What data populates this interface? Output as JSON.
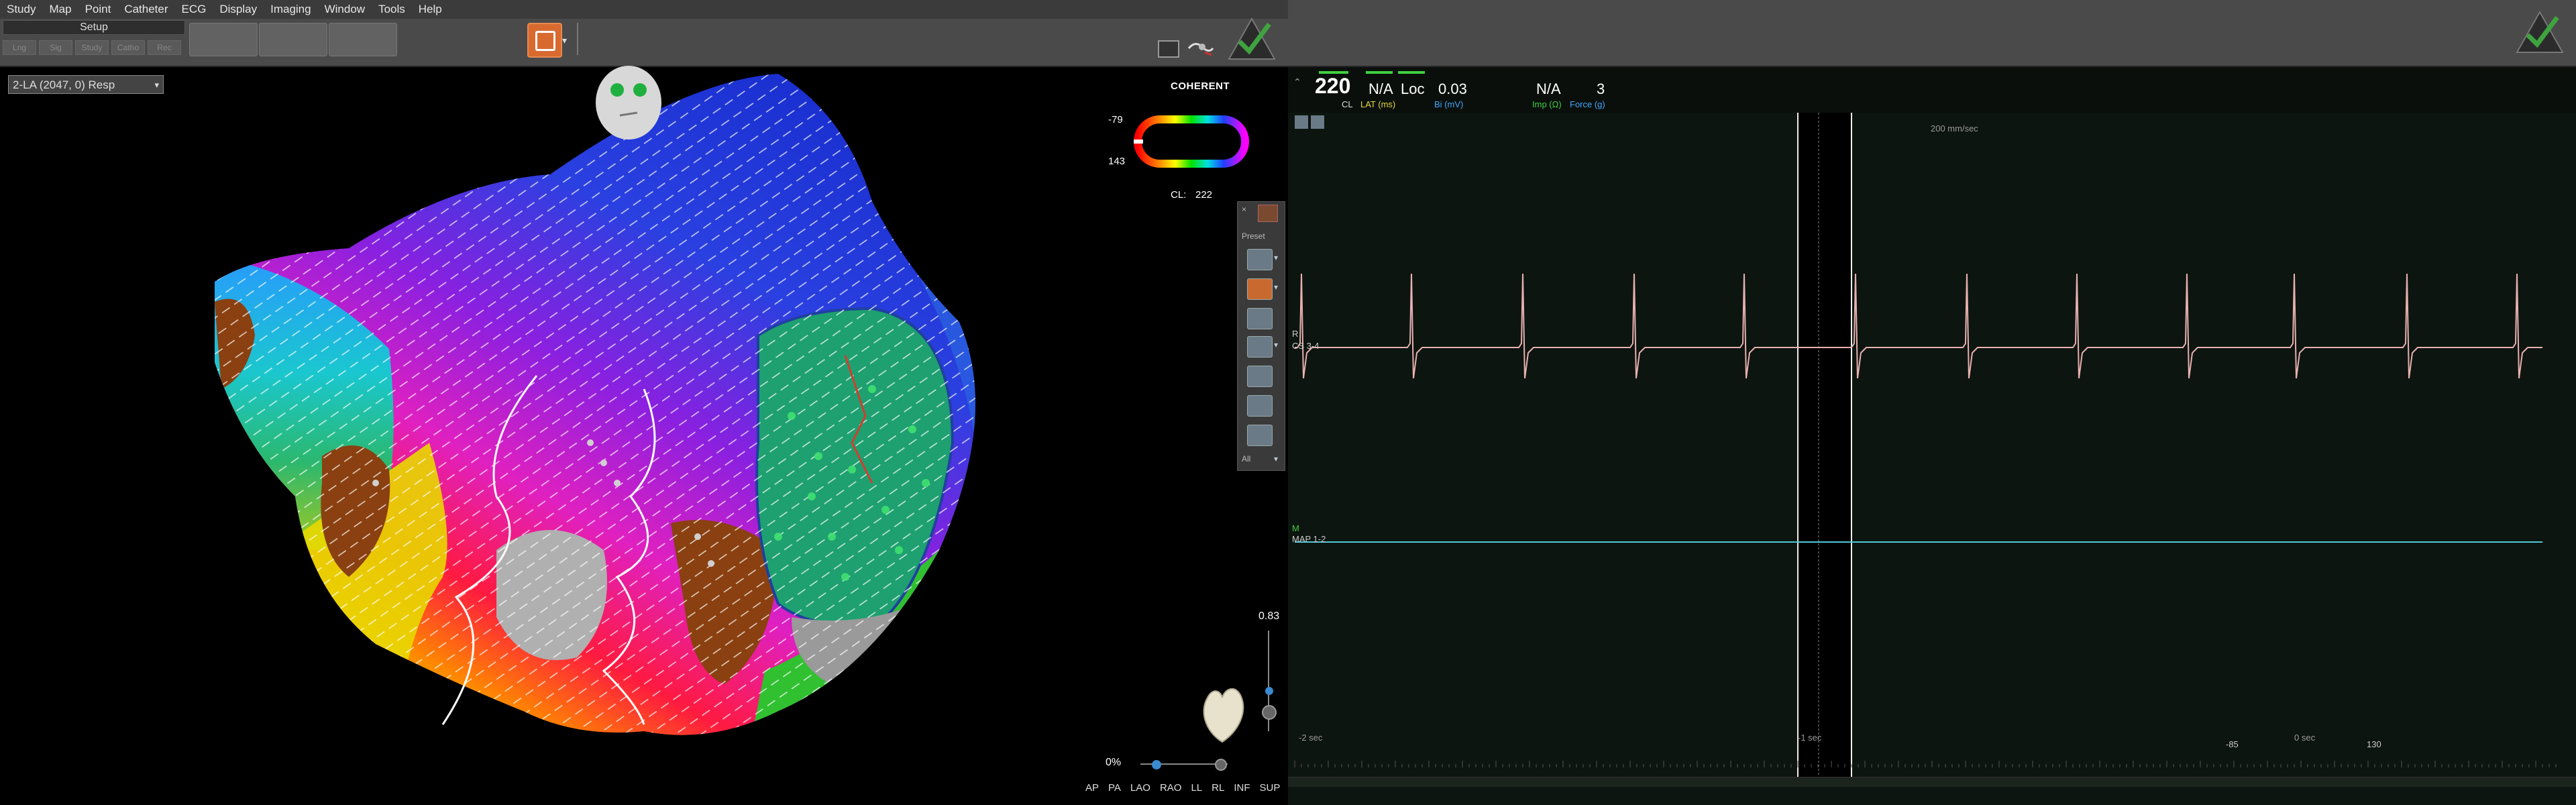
{
  "menu": [
    "Study",
    "Map",
    "Point",
    "Catheter",
    "ECG",
    "Display",
    "Imaging",
    "Window",
    "Tools",
    "Help"
  ],
  "setup": {
    "label": "Setup",
    "tabs": [
      "Lng",
      "Sig",
      "Study",
      "Catho",
      "Rec"
    ]
  },
  "map": {
    "selector": "2-LA (2047, 0) Resp",
    "mode": "COHERENT",
    "scale_top": "-79",
    "scale_bottom": "143",
    "cl_label": "CL:",
    "cl_value": "222",
    "zoom": "0.83",
    "opacity": "0%",
    "views": [
      "AP",
      "PA",
      "LAO",
      "RAO",
      "LL",
      "RL",
      "INF",
      "SUP"
    ],
    "tools_preset": "Preset",
    "tools_all": "All"
  },
  "ecg": {
    "cl": "220",
    "cl_label": "CL",
    "lat": "N/A",
    "lat_label": "LAT (ms)",
    "loc": "Loc",
    "bi": "0.03",
    "bi_label": "Bi (mV)",
    "imp": "N/A",
    "imp_label": "Imp (Ω)",
    "force": "3",
    "force_label": "Force (g)",
    "speed": "200 mm/sec",
    "ch1_label": "R",
    "ch1_name": "CS 3-4",
    "ch2_label": "M",
    "ch2_name": "MAP 1-2",
    "t_left": "-2 sec",
    "t_mid": "-1 sec",
    "t_zero": "0 sec",
    "marker_left": "-85",
    "marker_right": "130"
  },
  "colors": {
    "accent_orange": "#d86a30",
    "check_green": "#3fa33f",
    "ecg_trace": "#e8b0b0",
    "map_trace": "#4fc8d8"
  }
}
